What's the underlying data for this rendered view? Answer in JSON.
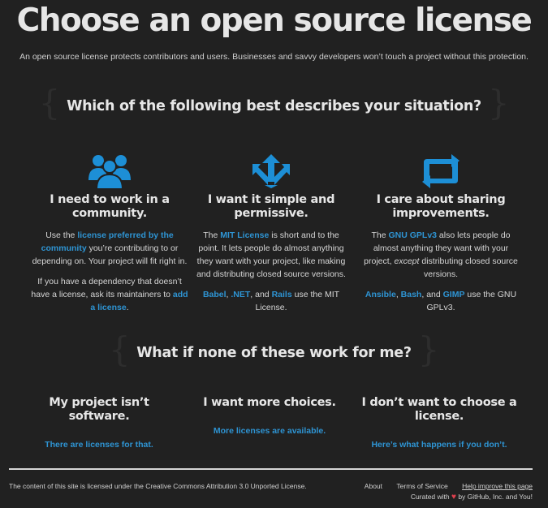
{
  "header": {
    "title": "Choose an open source license",
    "tagline": "An open source license protects contributors and users. Businesses and savvy developers won’t touch a project without this protection."
  },
  "situation": {
    "heading": "Which of the following best describes your situation?",
    "brace_open": "{",
    "brace_close": "}",
    "columns": [
      {
        "icon": "community-users-icon",
        "title": "I need to work in a community.",
        "p1_before": "Use the ",
        "p1_link": "license preferred by the community",
        "p1_after": " you’re contributing to or depending on. Your project will fit right in.",
        "p2_before": "If you have a dependency that doesn’t have a license, ask its maintainers to ",
        "p2_link": "add a license",
        "p2_after": "."
      },
      {
        "icon": "split-arrows-icon",
        "title": "I want it simple and permissive.",
        "p1_before": "The ",
        "p1_link": "MIT License",
        "p1_after": " is short and to the point. It lets people do almost anything they want with your project, like making and distributing closed source versions.",
        "p2_links": [
          "Babel",
          ".NET",
          "Rails"
        ],
        "p2_sep1": ", ",
        "p2_sep2": ", and ",
        "p2_after": " use the MIT License."
      },
      {
        "icon": "repeat-arrows-icon",
        "title": "I care about sharing improvements.",
        "p1_before": "The ",
        "p1_link": "GNU GPLv3",
        "p1_mid": " also lets people do almost anything they want with your project, ",
        "p1_em": "except",
        "p1_after": " distributing closed source versions.",
        "p2_links": [
          "Ansible",
          "Bash",
          "GIMP"
        ],
        "p2_sep1": ", ",
        "p2_sep2": ", and ",
        "p2_after": " use the GNU GPLv3."
      }
    ]
  },
  "none": {
    "heading": "What if none of these work for me?",
    "columns": [
      {
        "title": "My project isn’t software.",
        "link": "There are licenses for that."
      },
      {
        "title": "I want more choices.",
        "link": "More licenses are available."
      },
      {
        "title": "I don’t want to choose a license.",
        "link": "Here’s what happens if you don’t."
      }
    ]
  },
  "footer": {
    "license_before": "The content of this site is licensed under the ",
    "license_link": "Creative Commons Attribution 3.0 Unported License",
    "license_after": ".",
    "nav": [
      "About",
      "Terms of Service",
      "Help improve this page"
    ],
    "curated_before": "Curated with ",
    "heart": "♥",
    "curated_link": "by GitHub, Inc. and You!"
  },
  "colors": {
    "background": "#212121",
    "link": "#2e94d3",
    "icon": "#1d8fd6",
    "heart": "#e0404e"
  }
}
